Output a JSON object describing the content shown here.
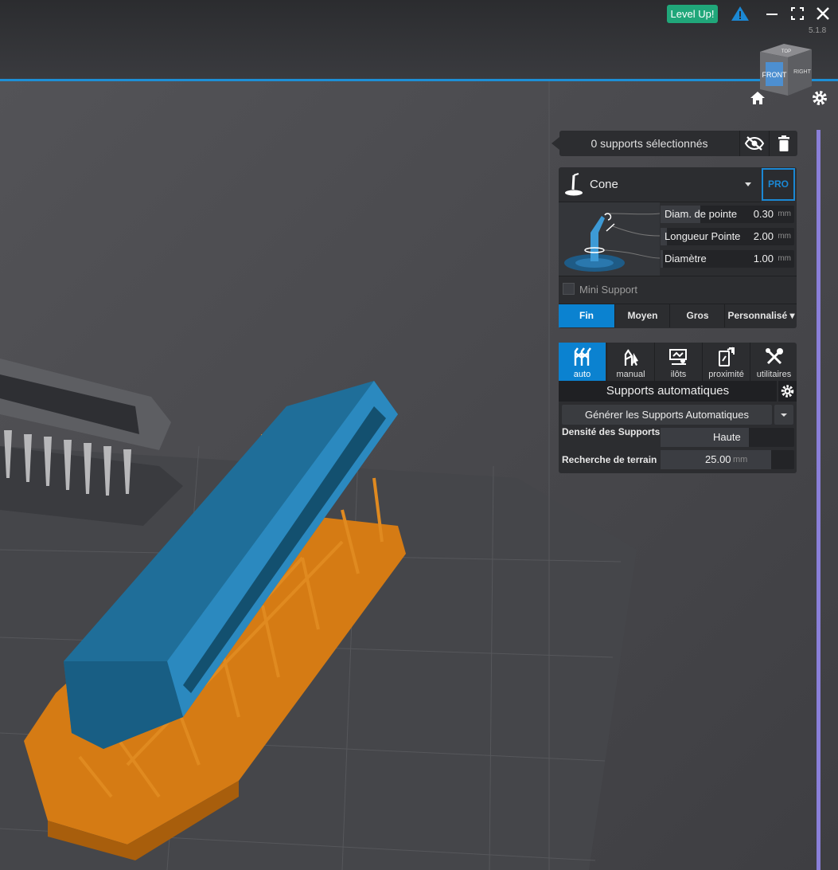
{
  "header": {
    "level_up_label": "Level Up!",
    "version": "5.1.8",
    "window_controls": [
      "minimize-icon",
      "maximize-icon",
      "close-icon"
    ],
    "accent_color": "#1d8fd6"
  },
  "view_cube": {
    "front": "FRONT",
    "right": "RIGHT",
    "top": "TOP"
  },
  "selection": {
    "text": "0 supports sélectionnés"
  },
  "support_type": {
    "name": "Cone",
    "pro_label": "PRO",
    "params": [
      {
        "label": "Diam. de pointe",
        "value": "0.30",
        "unit": "mm",
        "fill": 0.3
      },
      {
        "label": "Longueur Pointe",
        "value": "2.00",
        "unit": "mm",
        "fill": 0.05
      },
      {
        "label": "Diamètre",
        "value": "1.00",
        "unit": "mm",
        "fill": 0.02
      }
    ],
    "mini_support_label": "Mini Support",
    "presets": [
      "Fin",
      "Moyen",
      "Gros",
      "Personnalisé"
    ],
    "active_preset": "Fin"
  },
  "tools": {
    "tabs": [
      "auto",
      "manual",
      "ilôts",
      "proximité",
      "utilitaires"
    ],
    "active_tab": "auto",
    "section_title": "Supports automatiques",
    "generate_label": "Générer les Supports Automatiques",
    "density_label": "Densité des Supports",
    "density_value": "Haute",
    "density_fill": 0.66,
    "terrain_label": "Recherche de terrain",
    "terrain_value": "25.00",
    "terrain_unit": "mm",
    "terrain_fill": 0.83
  }
}
